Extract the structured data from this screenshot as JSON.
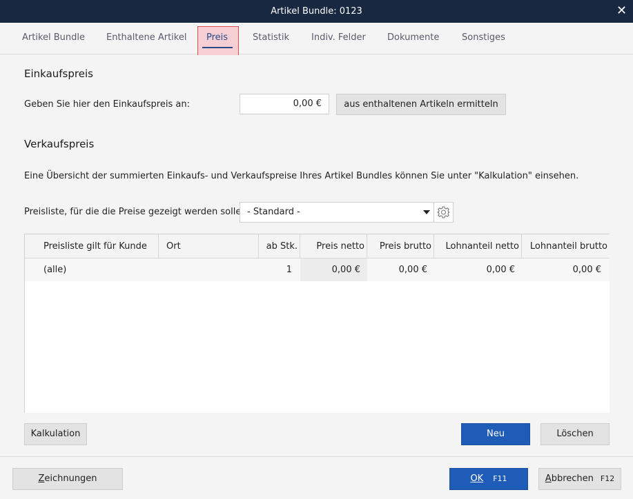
{
  "window": {
    "title": "Artikel Bundle: 0123",
    "close_glyph": "✕"
  },
  "tabs": [
    {
      "label": "Artikel Bundle"
    },
    {
      "label": "Enthaltene Artikel"
    },
    {
      "label": "Preis"
    },
    {
      "label": "Statistik"
    },
    {
      "label": "Indiv. Felder"
    },
    {
      "label": "Dokumente"
    },
    {
      "label": "Sonstiges"
    }
  ],
  "einkauf": {
    "title": "Einkaufspreis",
    "label": "Geben Sie hier den Einkaufspreis an:",
    "value": "0,00 €",
    "calc_button": "aus enthaltenen Artikeln ermitteln"
  },
  "verkauf": {
    "title": "Verkaufspreis",
    "info": "Eine Übersicht der summierten Einkaufs- und Verkaufspreise Ihres Artikel Bundles können Sie unter \"Kalkulation\" einsehen.",
    "pricelist_label": "Preisliste, für die die Preise gezeigt werden sollen:",
    "pricelist_value": "- Standard -"
  },
  "table": {
    "headers": [
      "Preisliste gilt für Kunde",
      "Ort",
      "ab Stk.",
      "Preis netto",
      "Preis brutto",
      "Lohnanteil netto",
      "Lohnanteil brutto"
    ],
    "rows": [
      [
        "(alle)",
        "",
        "1",
        "0,00 €",
        "0,00 €",
        "0,00 €",
        "0,00 €"
      ]
    ]
  },
  "buttons": {
    "kalkulation": "Kalkulation",
    "neu": "Neu",
    "loeschen": "Löschen"
  },
  "footer": {
    "zeichnungen_underlined": "Z",
    "zeichnungen_rest": "eichnungen",
    "ok_underlined": "OK",
    "ok_key": "F11",
    "abbrechen_underlined": "A",
    "abbrechen_rest": "bbrechen",
    "abbrechen_key": "F12"
  },
  "colors": {
    "titlebar": "#172840",
    "accent": "#1f5cb8",
    "tab_highlight": "#f6cfd4"
  }
}
